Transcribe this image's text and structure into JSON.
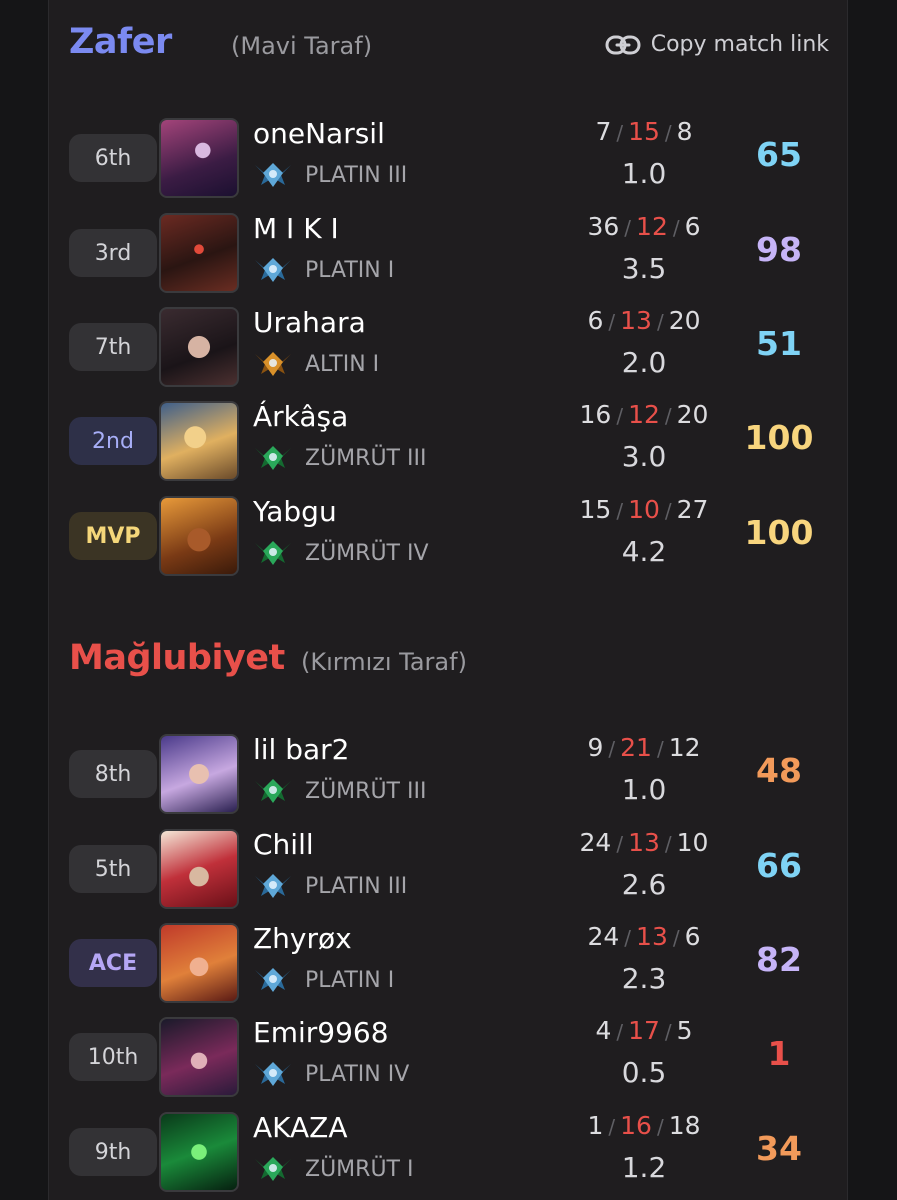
{
  "copy_link_label": "Copy match link",
  "teams": [
    {
      "title": "Zafer",
      "side": "(Mavi Taraf)",
      "color": "#7b8af0",
      "players": [
        {
          "rank": "6th",
          "name": "oneNarsil",
          "tier": "PLATIN III",
          "tier_icon": "platinum-emblem-icon",
          "kills": "7",
          "deaths": "15",
          "assists": "8",
          "ratio": "1.0",
          "score": "65",
          "score_color": "#7fd3f5"
        },
        {
          "rank": "3rd",
          "name": "M I K I",
          "tier": "PLATIN I",
          "tier_icon": "platinum-emblem-icon",
          "kills": "36",
          "deaths": "12",
          "assists": "6",
          "ratio": "3.5",
          "score": "98",
          "score_color": "#c6b4f7"
        },
        {
          "rank": "7th",
          "name": "Urahara",
          "tier": "ALTIN I",
          "tier_icon": "gold-emblem-icon",
          "kills": "6",
          "deaths": "13",
          "assists": "20",
          "ratio": "2.0",
          "score": "51",
          "score_color": "#7fd3f5"
        },
        {
          "rank": "2nd",
          "name": "Árkâşa",
          "tier": "ZÜMRÜT III",
          "tier_icon": "emerald-emblem-icon",
          "kills": "16",
          "deaths": "12",
          "assists": "20",
          "ratio": "3.0",
          "score": "100",
          "score_color": "#f8d57e"
        },
        {
          "rank": "MVP",
          "name": "Yabgu",
          "tier": "ZÜMRÜT IV",
          "tier_icon": "emerald-emblem-icon",
          "kills": "15",
          "deaths": "10",
          "assists": "27",
          "ratio": "4.2",
          "score": "100",
          "score_color": "#f8d57e"
        }
      ]
    },
    {
      "title": "Mağlubiyet",
      "side": "(Kırmızı Taraf)",
      "color": "#e8504a",
      "players": [
        {
          "rank": "8th",
          "name": "lil bar2",
          "tier": "ZÜMRÜT III",
          "tier_icon": "emerald-emblem-icon",
          "kills": "9",
          "deaths": "21",
          "assists": "12",
          "ratio": "1.0",
          "score": "48",
          "score_color": "#f29a5a"
        },
        {
          "rank": "5th",
          "name": "Chill",
          "tier": "PLATIN III",
          "tier_icon": "platinum-emblem-icon",
          "kills": "24",
          "deaths": "13",
          "assists": "10",
          "ratio": "2.6",
          "score": "66",
          "score_color": "#7fd3f5"
        },
        {
          "rank": "ACE",
          "name": "Zhyrøx",
          "tier": "PLATIN I",
          "tier_icon": "platinum-emblem-icon",
          "kills": "24",
          "deaths": "13",
          "assists": "6",
          "ratio": "2.3",
          "score": "82",
          "score_color": "#c6b4f7"
        },
        {
          "rank": "10th",
          "name": "Emir9968",
          "tier": "PLATIN IV",
          "tier_icon": "platinum-emblem-icon",
          "kills": "4",
          "deaths": "17",
          "assists": "5",
          "ratio": "0.5",
          "score": "1",
          "score_color": "#e8504a"
        },
        {
          "rank": "9th",
          "name": "AKAZA",
          "tier": "ZÜMRÜT I",
          "tier_icon": "emerald-emblem-icon",
          "kills": "1",
          "deaths": "16",
          "assists": "18",
          "ratio": "1.2",
          "score": "34",
          "score_color": "#f29a5a"
        }
      ]
    }
  ]
}
